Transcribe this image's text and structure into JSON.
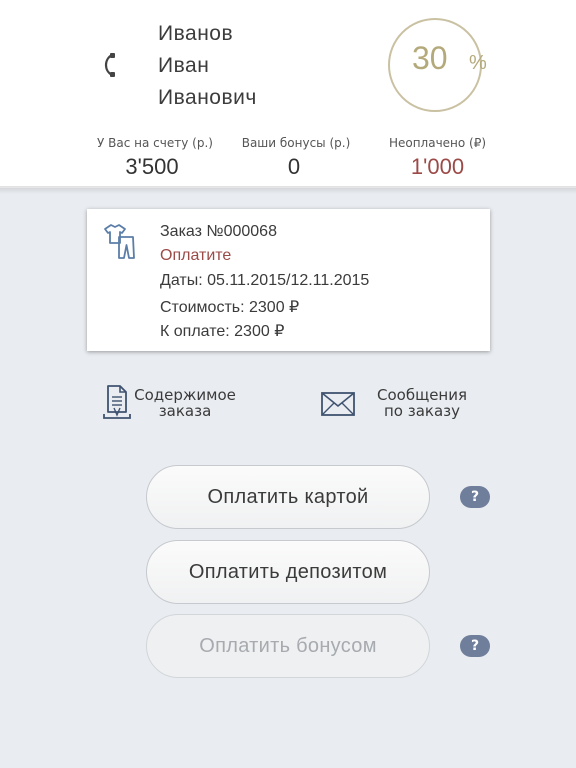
{
  "user": {
    "last_name": "Иванов",
    "first_name": "Иван",
    "middle_name": "Иванович"
  },
  "discount": {
    "value": "30",
    "unit": "%",
    "level": 0.3
  },
  "balance": {
    "account_label": "У Вас на счету (р.)",
    "account_value": "3'500",
    "bonus_label": "Ваши бонусы (р.)",
    "bonus_value": "0",
    "unpaid_label": "Неоплачено (₽)",
    "unpaid_value": "1'000"
  },
  "order": {
    "title": "Заказ №000068",
    "status": "Оплатите",
    "dates": "Даты: 05.11.2015/12.11.2015",
    "cost": "Стоимость: 2300 ₽",
    "to_pay": "К оплате: 2300 ₽"
  },
  "links": {
    "contents_line1": "Содержимое",
    "contents_line2": "заказа",
    "messages_line1": "Сообщения",
    "messages_line2": "по заказу"
  },
  "buttons": {
    "pay_card": "Оплатить картой",
    "pay_deposit": "Оплатить депозитом",
    "pay_bonus": "Оплатить бонусом",
    "help": "?"
  },
  "colors": {
    "accent_gold": "#b4a97a",
    "alert_red": "#9b4a47",
    "help_badge": "#6f7e9a"
  },
  "icons": {
    "phone": "phone-icon",
    "clothes": "clothes-icon",
    "document": "document-icon",
    "envelope": "envelope-icon"
  }
}
